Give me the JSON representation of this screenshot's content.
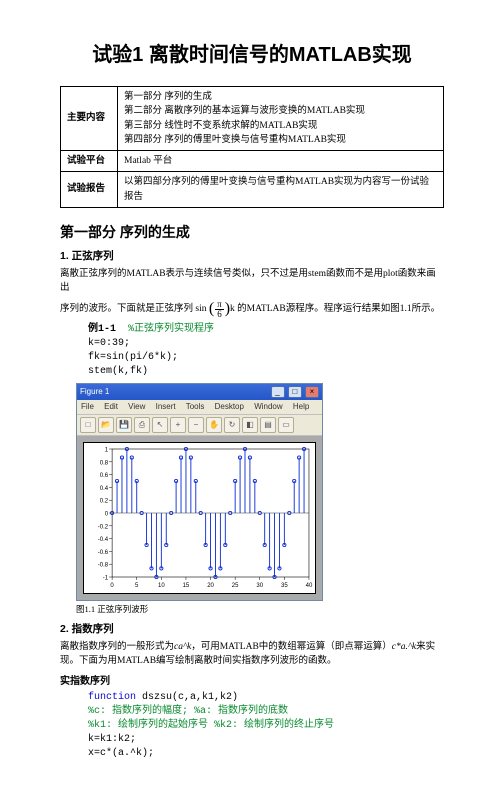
{
  "title": "试验1 离散时间信号的MATLAB实现",
  "table": {
    "row1_label": "主要内容",
    "row1_text": "第一部分 序列的生成\n第二部分 离散序列的基本运算与波形变换的MATLAB实现\n第三部分 线性时不变系统求解的MATLAB实现\n第四部分 序列的傅里叶变换与信号重构MATLAB实现",
    "row2_label": "试验平台",
    "row2_text": "Matlab 平台",
    "row3_label": "试验报告",
    "row3_text": "以第四部分序列的傅里叶变换与信号重构MATLAB实现为内容写一份试验报告"
  },
  "section1_heading": "第一部分 序列的生成",
  "sub1_heading": "1. 正弦序列",
  "para1a": "离散正弦序列的MATLAB表示与连续信号类似，只不过是用stem函数而不是用plot函数来画出",
  "para1b_prefix": "序列的波形。下面就是正弦序列 sin",
  "frac_num": "π",
  "frac_den": "6",
  "para1b_suffix": "k 的MATLAB源程序。程序运行结果如图1.1所示。",
  "example1_label": "例1-1",
  "example1_comment": "%正弦序列实现程序",
  "code1_line1": "k=0:39;",
  "code1_line2": "fk=sin(pi/6*k);",
  "code1_line3": "stem(k,fk)",
  "fig_window": {
    "title": "Figure 1",
    "menu": [
      "File",
      "Edit",
      "View",
      "Insert",
      "Tools",
      "Desktop",
      "Window",
      "Help"
    ]
  },
  "caption1": "图1.1 正弦序列波形",
  "sub2_heading": "2. 指数序列",
  "para2a_prefix": "离散指数序列的一般形式为",
  "para2a_formula": "ca^k",
  "para2a_mid": "，可用MATLAB中的数组幂运算（即点幂运算）",
  "para2a_code": "c*a.^k",
  "para2a_suffix": "来实现。下面为用MATLAB编写绘制离散时间实指数序列波形的函数。",
  "sub2b_heading": "实指数序列",
  "code2_line1_kw": "function",
  "code2_line1_rest": " dszsu(c,a,k1,k2)",
  "code2_line2": "%c: 指数序列的幅度; %a: 指数序列的底数",
  "code2_line3": "%k1: 绘制序列的起始序号 %k2: 绘制序列的终止序号",
  "code2_line4": "k=k1:k2;",
  "code2_line5": "x=c*(a.^k);",
  "chart_data": {
    "type": "stem",
    "title": "",
    "xlabel": "",
    "ylabel": "",
    "xlim": [
      0,
      40
    ],
    "ylim": [
      -1,
      1
    ],
    "xticks": [
      0,
      5,
      10,
      15,
      20,
      25,
      30,
      35,
      40
    ],
    "yticks": [
      -1,
      -0.8,
      -0.6,
      -0.4,
      -0.2,
      0,
      0.2,
      0.4,
      0.6,
      0.8,
      1
    ],
    "x": [
      0,
      1,
      2,
      3,
      4,
      5,
      6,
      7,
      8,
      9,
      10,
      11,
      12,
      13,
      14,
      15,
      16,
      17,
      18,
      19,
      20,
      21,
      22,
      23,
      24,
      25,
      26,
      27,
      28,
      29,
      30,
      31,
      32,
      33,
      34,
      35,
      36,
      37,
      38,
      39
    ],
    "y": [
      0,
      0.5,
      0.866,
      1,
      0.866,
      0.5,
      0,
      -0.5,
      -0.866,
      -1,
      -0.866,
      -0.5,
      0,
      0.5,
      0.866,
      1,
      0.866,
      0.5,
      0,
      -0.5,
      -0.866,
      -1,
      -0.866,
      -0.5,
      0,
      0.5,
      0.866,
      1,
      0.866,
      0.5,
      0,
      -0.5,
      -0.866,
      -1,
      -0.866,
      -0.5,
      0,
      0.5,
      0.866,
      1
    ]
  }
}
